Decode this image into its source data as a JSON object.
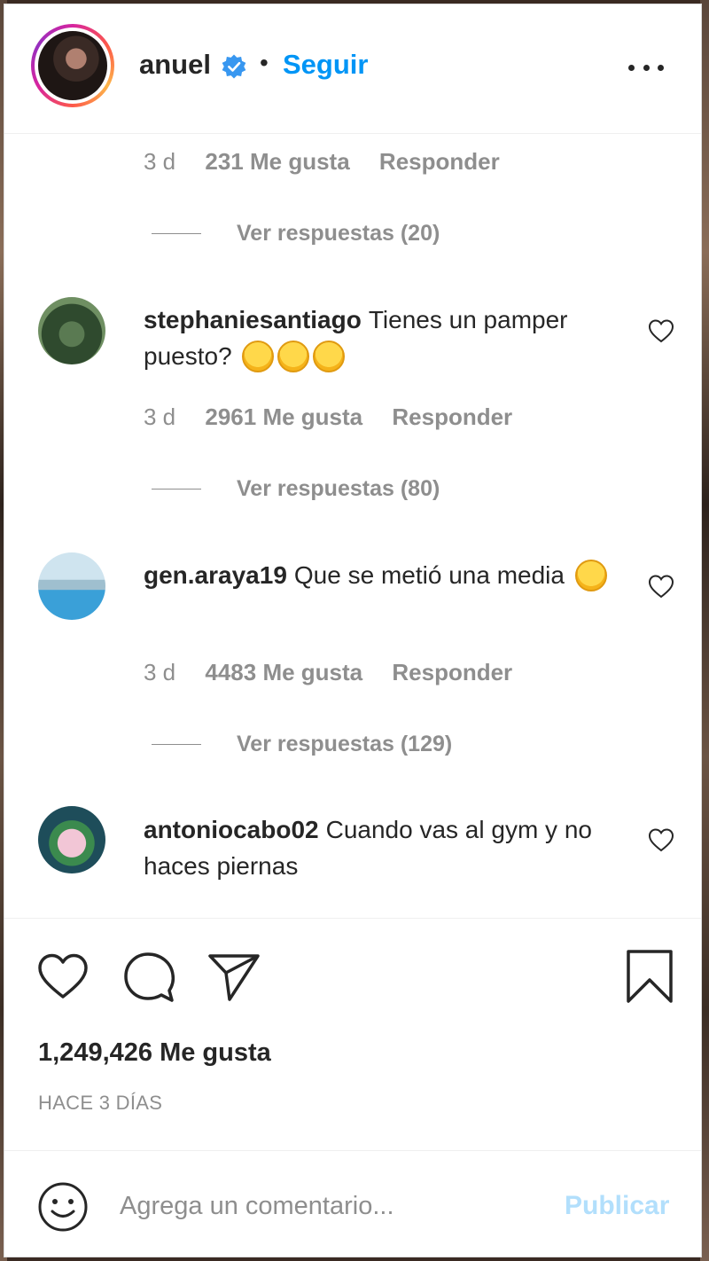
{
  "header": {
    "username": "anuel",
    "separator": "•",
    "follow_label": "Seguir"
  },
  "comments": [
    {
      "time": "3 d",
      "likes": "231 Me gusta",
      "reply_label": "Responder",
      "view_replies": "Ver respuestas (20)"
    },
    {
      "username": "stephaniesantiago",
      "text": "Tienes un pamper puesto?",
      "emoji": [
        "rolling-on-floor-laughing",
        "rolling-on-floor-laughing",
        "rolling-on-floor-laughing"
      ],
      "time": "3 d",
      "likes": "2961 Me gusta",
      "reply_label": "Responder",
      "view_replies": "Ver respuestas (80)"
    },
    {
      "username": "gen.araya19",
      "text": "Que se metió una media",
      "emoji": [
        "face-with-tears-of-joy"
      ],
      "time": "3 d",
      "likes": "4483 Me gusta",
      "reply_label": "Responder",
      "view_replies": "Ver respuestas (129)"
    },
    {
      "username": "antoniocabo02",
      "text": "Cuando vas al gym y no haces piernas"
    }
  ],
  "actions": {
    "likes_total": "1,249,426 Me gusta",
    "date": "HACE 3 DÍAS"
  },
  "composer": {
    "placeholder": "Agrega un comentario...",
    "publish_label": "Publicar"
  },
  "colors": {
    "link_blue": "#0095f6",
    "publish_disabled": "#b2dffc",
    "muted_text": "#8e8e8e",
    "primary_text": "#262626"
  }
}
